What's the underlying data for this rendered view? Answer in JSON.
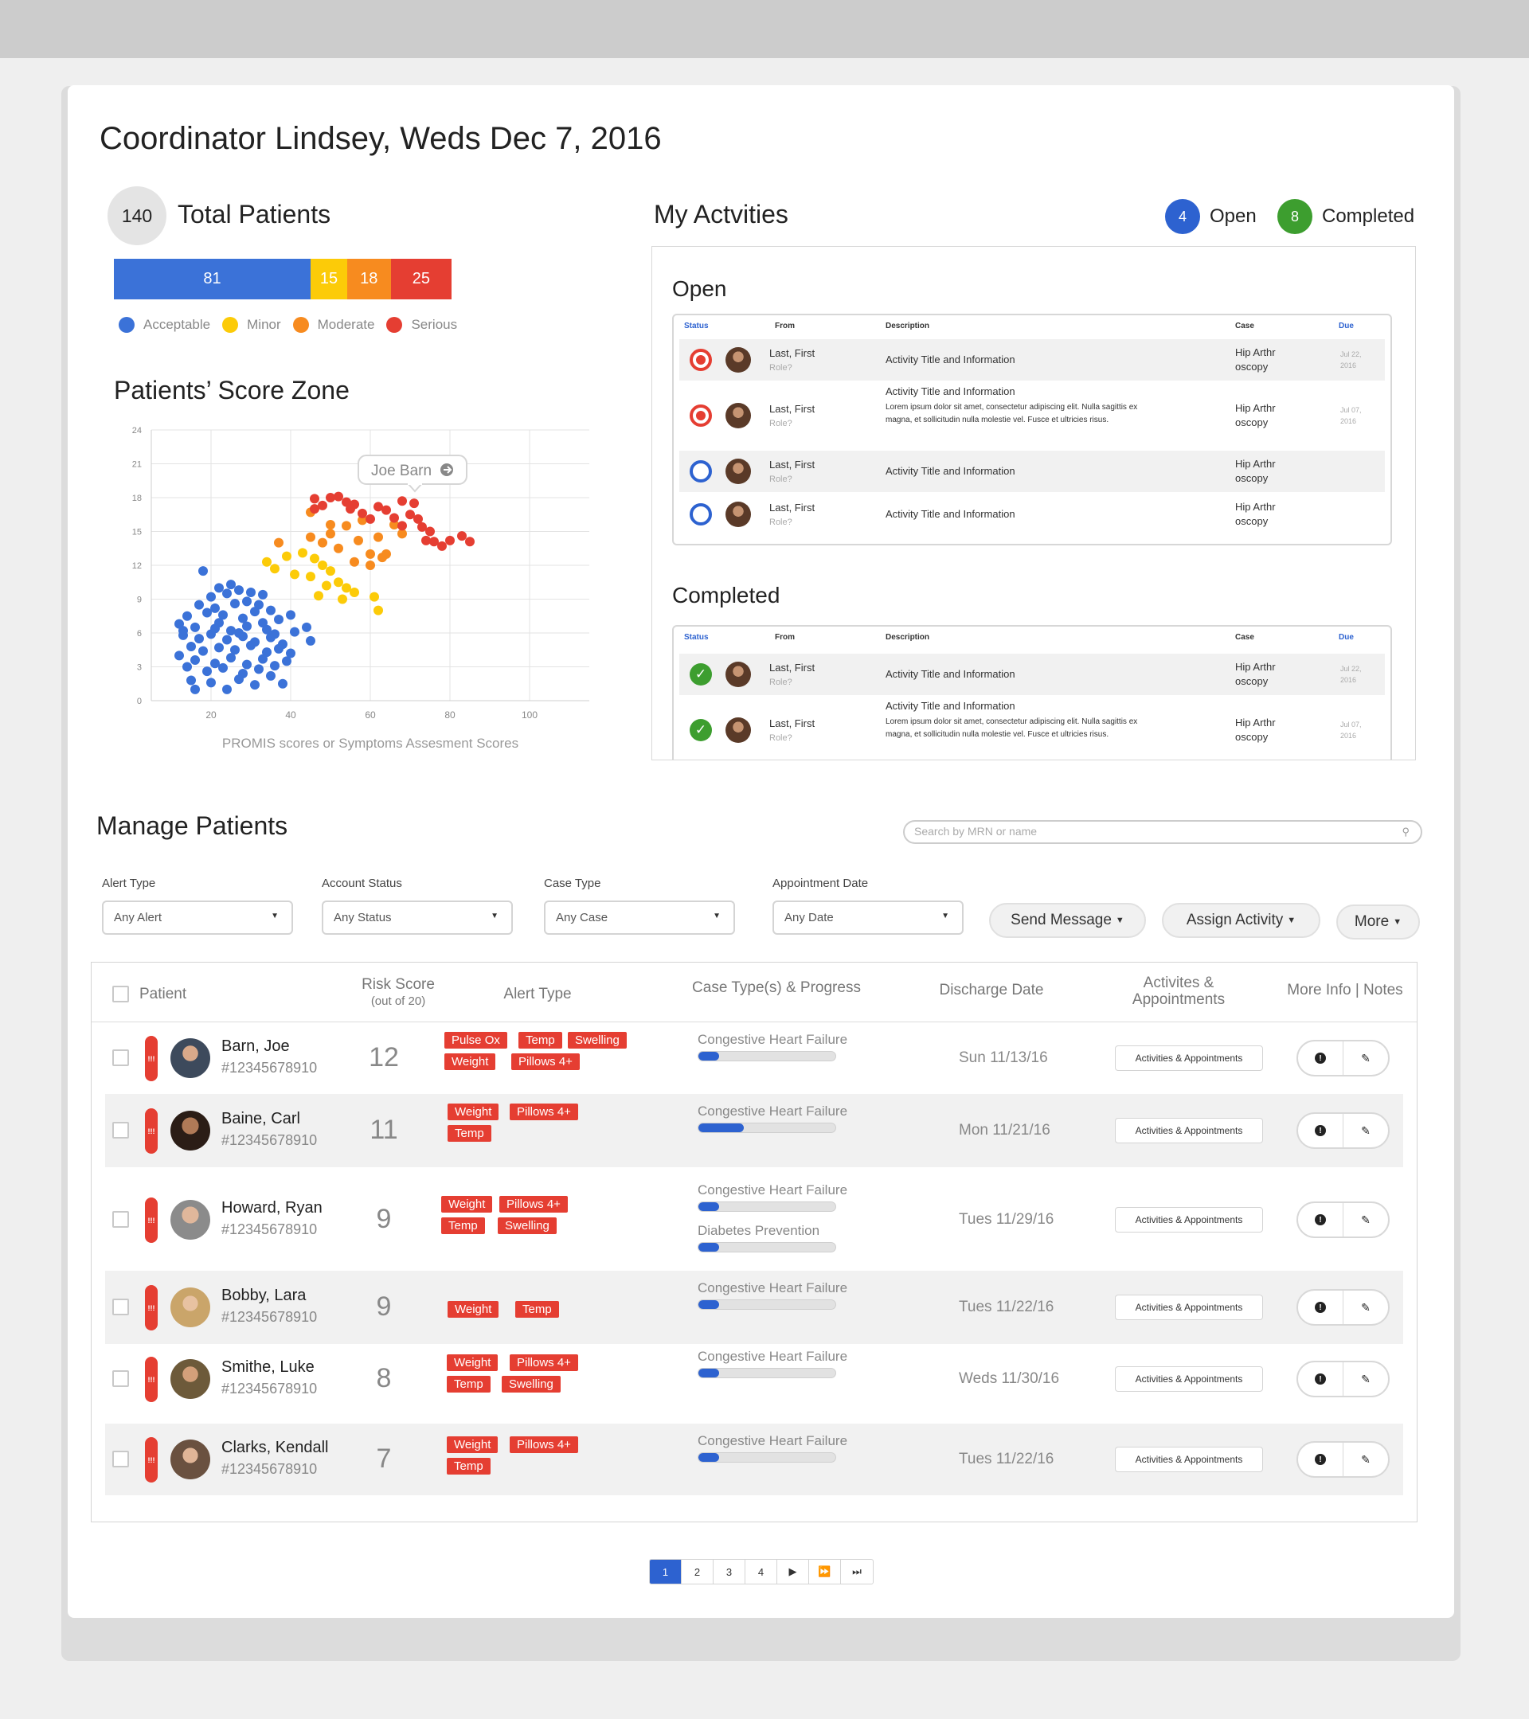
{
  "header": {
    "title": "Coordinator Lindsey, Weds Dec 7, 2016"
  },
  "total_patients": {
    "count": "140",
    "label": "Total Patients",
    "segments": [
      {
        "value": "81",
        "color": "#3b72d8"
      },
      {
        "value": "15",
        "color": "#fccb08"
      },
      {
        "value": "18",
        "color": "#f78b1f"
      },
      {
        "value": "25",
        "color": "#e53e32"
      }
    ],
    "legend": [
      {
        "label": "Acceptable",
        "color": "#3b72d8"
      },
      {
        "label": "Minor",
        "color": "#fccb08"
      },
      {
        "label": "Moderate",
        "color": "#f78b1f"
      },
      {
        "label": "Serious",
        "color": "#e53e32"
      }
    ]
  },
  "score_zone": {
    "title": "Patients’ Score Zone",
    "tooltip": "Joe Barn"
  },
  "chart_data": {
    "type": "scatter",
    "xlabel": "PROMIS scores or Symptoms Assesment Scores",
    "ylabel": "",
    "xlim": [
      5,
      115
    ],
    "ylim": [
      0,
      24
    ],
    "xticks": [
      "20",
      "40",
      "60",
      "80",
      "100"
    ],
    "yticks": [
      "0",
      "3",
      "6",
      "9",
      "12",
      "15",
      "18",
      "21",
      "24"
    ],
    "grid": true,
    "series": [
      {
        "color": "#3b72d8",
        "points": [
          [
            18,
            11.5
          ],
          [
            22,
            10
          ],
          [
            25,
            10.3
          ],
          [
            20,
            9.2
          ],
          [
            24,
            9.5
          ],
          [
            27,
            9.8
          ],
          [
            30,
            9.6
          ],
          [
            17,
            8.5
          ],
          [
            21,
            8.2
          ],
          [
            26,
            8.6
          ],
          [
            29,
            8.8
          ],
          [
            32,
            8.5
          ],
          [
            33,
            9.4
          ],
          [
            14,
            7.5
          ],
          [
            19,
            7.8
          ],
          [
            23,
            7.6
          ],
          [
            28,
            7.3
          ],
          [
            31,
            7.9
          ],
          [
            35,
            8.0
          ],
          [
            12,
            6.8
          ],
          [
            16,
            6.5
          ],
          [
            22,
            6.9
          ],
          [
            25,
            6.2
          ],
          [
            29,
            6.6
          ],
          [
            33,
            6.9
          ],
          [
            37,
            7.2
          ],
          [
            40,
            7.6
          ],
          [
            13,
            5.8
          ],
          [
            17,
            5.5
          ],
          [
            20,
            5.9
          ],
          [
            24,
            5.4
          ],
          [
            28,
            5.7
          ],
          [
            31,
            5.2
          ],
          [
            35,
            5.6
          ],
          [
            38,
            5.0
          ],
          [
            41,
            6.1
          ],
          [
            44,
            6.5
          ],
          [
            15,
            4.8
          ],
          [
            18,
            4.4
          ],
          [
            22,
            4.7
          ],
          [
            26,
            4.5
          ],
          [
            30,
            4.9
          ],
          [
            34,
            4.3
          ],
          [
            37,
            4.6
          ],
          [
            40,
            4.2
          ],
          [
            12,
            4.0
          ],
          [
            16,
            3.6
          ],
          [
            21,
            3.3
          ],
          [
            25,
            3.8
          ],
          [
            29,
            3.2
          ],
          [
            33,
            3.7
          ],
          [
            36,
            3.1
          ],
          [
            39,
            3.5
          ],
          [
            14,
            3.0
          ],
          [
            19,
            2.6
          ],
          [
            23,
            2.9
          ],
          [
            28,
            2.4
          ],
          [
            32,
            2.8
          ],
          [
            35,
            2.2
          ],
          [
            15,
            1.8
          ],
          [
            20,
            1.6
          ],
          [
            27,
            1.9
          ],
          [
            31,
            1.4
          ],
          [
            38,
            1.5
          ],
          [
            24,
            1.0
          ],
          [
            16,
            1.0
          ],
          [
            13,
            6.2
          ],
          [
            21,
            6.4
          ],
          [
            27,
            6.0
          ],
          [
            34,
            6.3
          ],
          [
            45,
            5.3
          ],
          [
            36,
            5.9
          ]
        ]
      },
      {
        "color": "#fccb08",
        "points": [
          [
            34,
            12.3
          ],
          [
            36,
            11.7
          ],
          [
            39,
            12.8
          ],
          [
            41,
            11.2
          ],
          [
            43,
            13.1
          ],
          [
            46,
            12.6
          ],
          [
            45,
            11.0
          ],
          [
            48,
            12.0
          ],
          [
            50,
            11.5
          ],
          [
            52,
            10.5
          ],
          [
            49,
            10.2
          ],
          [
            54,
            10.0
          ],
          [
            56,
            9.6
          ],
          [
            47,
            9.3
          ],
          [
            53,
            9.0
          ],
          [
            61,
            9.2
          ],
          [
            62,
            8.0
          ]
        ]
      },
      {
        "color": "#f78b1f",
        "points": [
          [
            37,
            14.0
          ],
          [
            45,
            14.5
          ],
          [
            50,
            14.8
          ],
          [
            52,
            13.5
          ],
          [
            54,
            15.5
          ],
          [
            57,
            14.2
          ],
          [
            56,
            12.3
          ],
          [
            60,
            13.0
          ],
          [
            62,
            14.5
          ],
          [
            64,
            13.0
          ],
          [
            66,
            15.6
          ],
          [
            68,
            14.8
          ],
          [
            50,
            15.6
          ],
          [
            45,
            16.7
          ],
          [
            60,
            12.0
          ],
          [
            48,
            14.0
          ],
          [
            63,
            12.7
          ],
          [
            58,
            16.0
          ]
        ]
      },
      {
        "color": "#e53e32",
        "points": [
          [
            46,
            17.9
          ],
          [
            48,
            17.3
          ],
          [
            50,
            18.0
          ],
          [
            52,
            18.1
          ],
          [
            54,
            17.6
          ],
          [
            56,
            17.4
          ],
          [
            58,
            16.6
          ],
          [
            60,
            16.1
          ],
          [
            62,
            17.2
          ],
          [
            64,
            16.9
          ],
          [
            66,
            16.2
          ],
          [
            68,
            17.7
          ],
          [
            70,
            16.5
          ],
          [
            72,
            16.1
          ],
          [
            73,
            15.4
          ],
          [
            74,
            14.2
          ],
          [
            76,
            14.1
          ],
          [
            78,
            13.7
          ],
          [
            80,
            14.2
          ],
          [
            83,
            14.6
          ],
          [
            85,
            14.1
          ],
          [
            71,
            17.5
          ],
          [
            55,
            17.0
          ],
          [
            68,
            15.5
          ],
          [
            75,
            15.0
          ],
          [
            46,
            17.0
          ]
        ]
      }
    ]
  },
  "activities": {
    "title": "My Actvities",
    "open_count": "4",
    "open_label": "Open",
    "completed_count": "8",
    "completed_label": "Completed",
    "open_section_title": "Open",
    "completed_section_title": "Completed",
    "columns": {
      "status": "Status",
      "from": "From",
      "description": "Description",
      "case": "Case",
      "due": "Due"
    },
    "open_rows": [
      {
        "status": "alert",
        "name": "Last, First",
        "role": "Role?",
        "title": "Activity Title and Information",
        "lorem": "",
        "case": "Hip Arthr oscopy",
        "due": "Jul 22, 2016"
      },
      {
        "status": "alert",
        "name": "Last, First",
        "role": "Role?",
        "title": "Activity Title and Information",
        "lorem": "Lorem ipsum dolor sit amet, consectetur adipiscing elit. Nulla sagittis ex magna, et sollicitudin nulla molestie vel. Fusce et ultricies risus.",
        "case": "Hip Arthr oscopy",
        "due": "Jul 07, 2016"
      },
      {
        "status": "open",
        "name": "Last, First",
        "role": "Role?",
        "title": "Activity Title and Information",
        "lorem": "",
        "case": "Hip Arthr oscopy",
        "due": ""
      },
      {
        "status": "open",
        "name": "Last, First",
        "role": "Role?",
        "title": "Activity Title and Information",
        "lorem": "",
        "case": "Hip Arthr oscopy",
        "due": ""
      }
    ],
    "completed_rows": [
      {
        "status": "done",
        "name": "Last, First",
        "role": "Role?",
        "title": "Activity Title and Information",
        "lorem": "",
        "case": "Hip Arthr oscopy",
        "due": "Jul 22, 2016"
      },
      {
        "status": "done",
        "name": "Last, First",
        "role": "Role?",
        "title": "Activity Title and Information",
        "lorem": "Lorem ipsum dolor sit amet, consectetur adipiscing elit. Nulla sagittis ex magna, et sollicitudin nulla molestie vel. Fusce et ultricies risus.",
        "case": "Hip Arthr oscopy",
        "due": "Jul 07, 2016"
      }
    ]
  },
  "manage": {
    "title": "Manage Patients",
    "search_placeholder": "Search by MRN or name",
    "filters": [
      {
        "label": "Alert Type",
        "value": "Any Alert"
      },
      {
        "label": "Account Status",
        "value": "Any Status"
      },
      {
        "label": "Case Type",
        "value": "Any Case"
      },
      {
        "label": "Appointment Date",
        "value": "Any Date"
      }
    ],
    "send_message": "Send Message",
    "assign_activity": "Assign Activity",
    "more": "More"
  },
  "table": {
    "columns": {
      "patient": "Patient",
      "risk": "Risk Score",
      "risk_sub": "(out of 20)",
      "alert": "Alert Type",
      "case": "Case Type(s) & Progress",
      "discharge": "Discharge Date",
      "activities_1": "Activites &",
      "activities_2": "Appointments",
      "more": "More Info | Notes"
    },
    "activities_button": "Activities & Appointments",
    "alert_mark": "!!!",
    "rows": [
      {
        "name": "Barn, Joe",
        "mrn": "#12345678910",
        "risk": "12",
        "discharge": "Sun 11/13/16",
        "tags": [
          "Pulse Ox",
          "Temp",
          "Swelling",
          "Weight",
          "Pillows 4+"
        ],
        "cases": [
          {
            "name": "Congestive Heart Failure",
            "progress": 0.15
          }
        ]
      },
      {
        "name": "Baine, Carl",
        "mrn": "#12345678910",
        "risk": "11",
        "discharge": "Mon 11/21/16",
        "tags": [
          "Weight",
          "Pillows 4+",
          "Temp"
        ],
        "cases": [
          {
            "name": "Congestive Heart Failure",
            "progress": 0.33
          }
        ]
      },
      {
        "name": "Howard, Ryan",
        "mrn": "#12345678910",
        "risk": "9",
        "discharge": "Tues 11/29/16",
        "tags": [
          "Weight",
          "Pillows 4+",
          "Temp",
          "Swelling"
        ],
        "cases": [
          {
            "name": "Congestive Heart Failure",
            "progress": 0.15
          },
          {
            "name": "Diabetes Prevention",
            "progress": 0.15
          }
        ]
      },
      {
        "name": "Bobby, Lara",
        "mrn": "#12345678910",
        "risk": "9",
        "discharge": "Tues 11/22/16",
        "tags": [
          "Weight",
          "Temp"
        ],
        "cases": [
          {
            "name": "Congestive Heart Failure",
            "progress": 0.15
          }
        ]
      },
      {
        "name": "Smithe, Luke",
        "mrn": "#12345678910",
        "risk": "8",
        "discharge": "Weds 11/30/16",
        "tags": [
          "Weight",
          "Pillows 4+",
          "Temp",
          "Swelling"
        ],
        "cases": [
          {
            "name": "Congestive Heart Failure",
            "progress": 0.15
          }
        ]
      },
      {
        "name": "Clarks, Kendall",
        "mrn": "#12345678910",
        "risk": "7",
        "discharge": "Tues 11/22/16",
        "tags": [
          "Weight",
          "Pillows 4+",
          "Temp"
        ],
        "cases": [
          {
            "name": "Congestive Heart Failure",
            "progress": 0.15
          }
        ]
      }
    ]
  },
  "pagination": {
    "pages": [
      "1",
      "2",
      "3",
      "4"
    ],
    "next": "▶",
    "fast_forward": "⏩",
    "last": "⏭"
  }
}
